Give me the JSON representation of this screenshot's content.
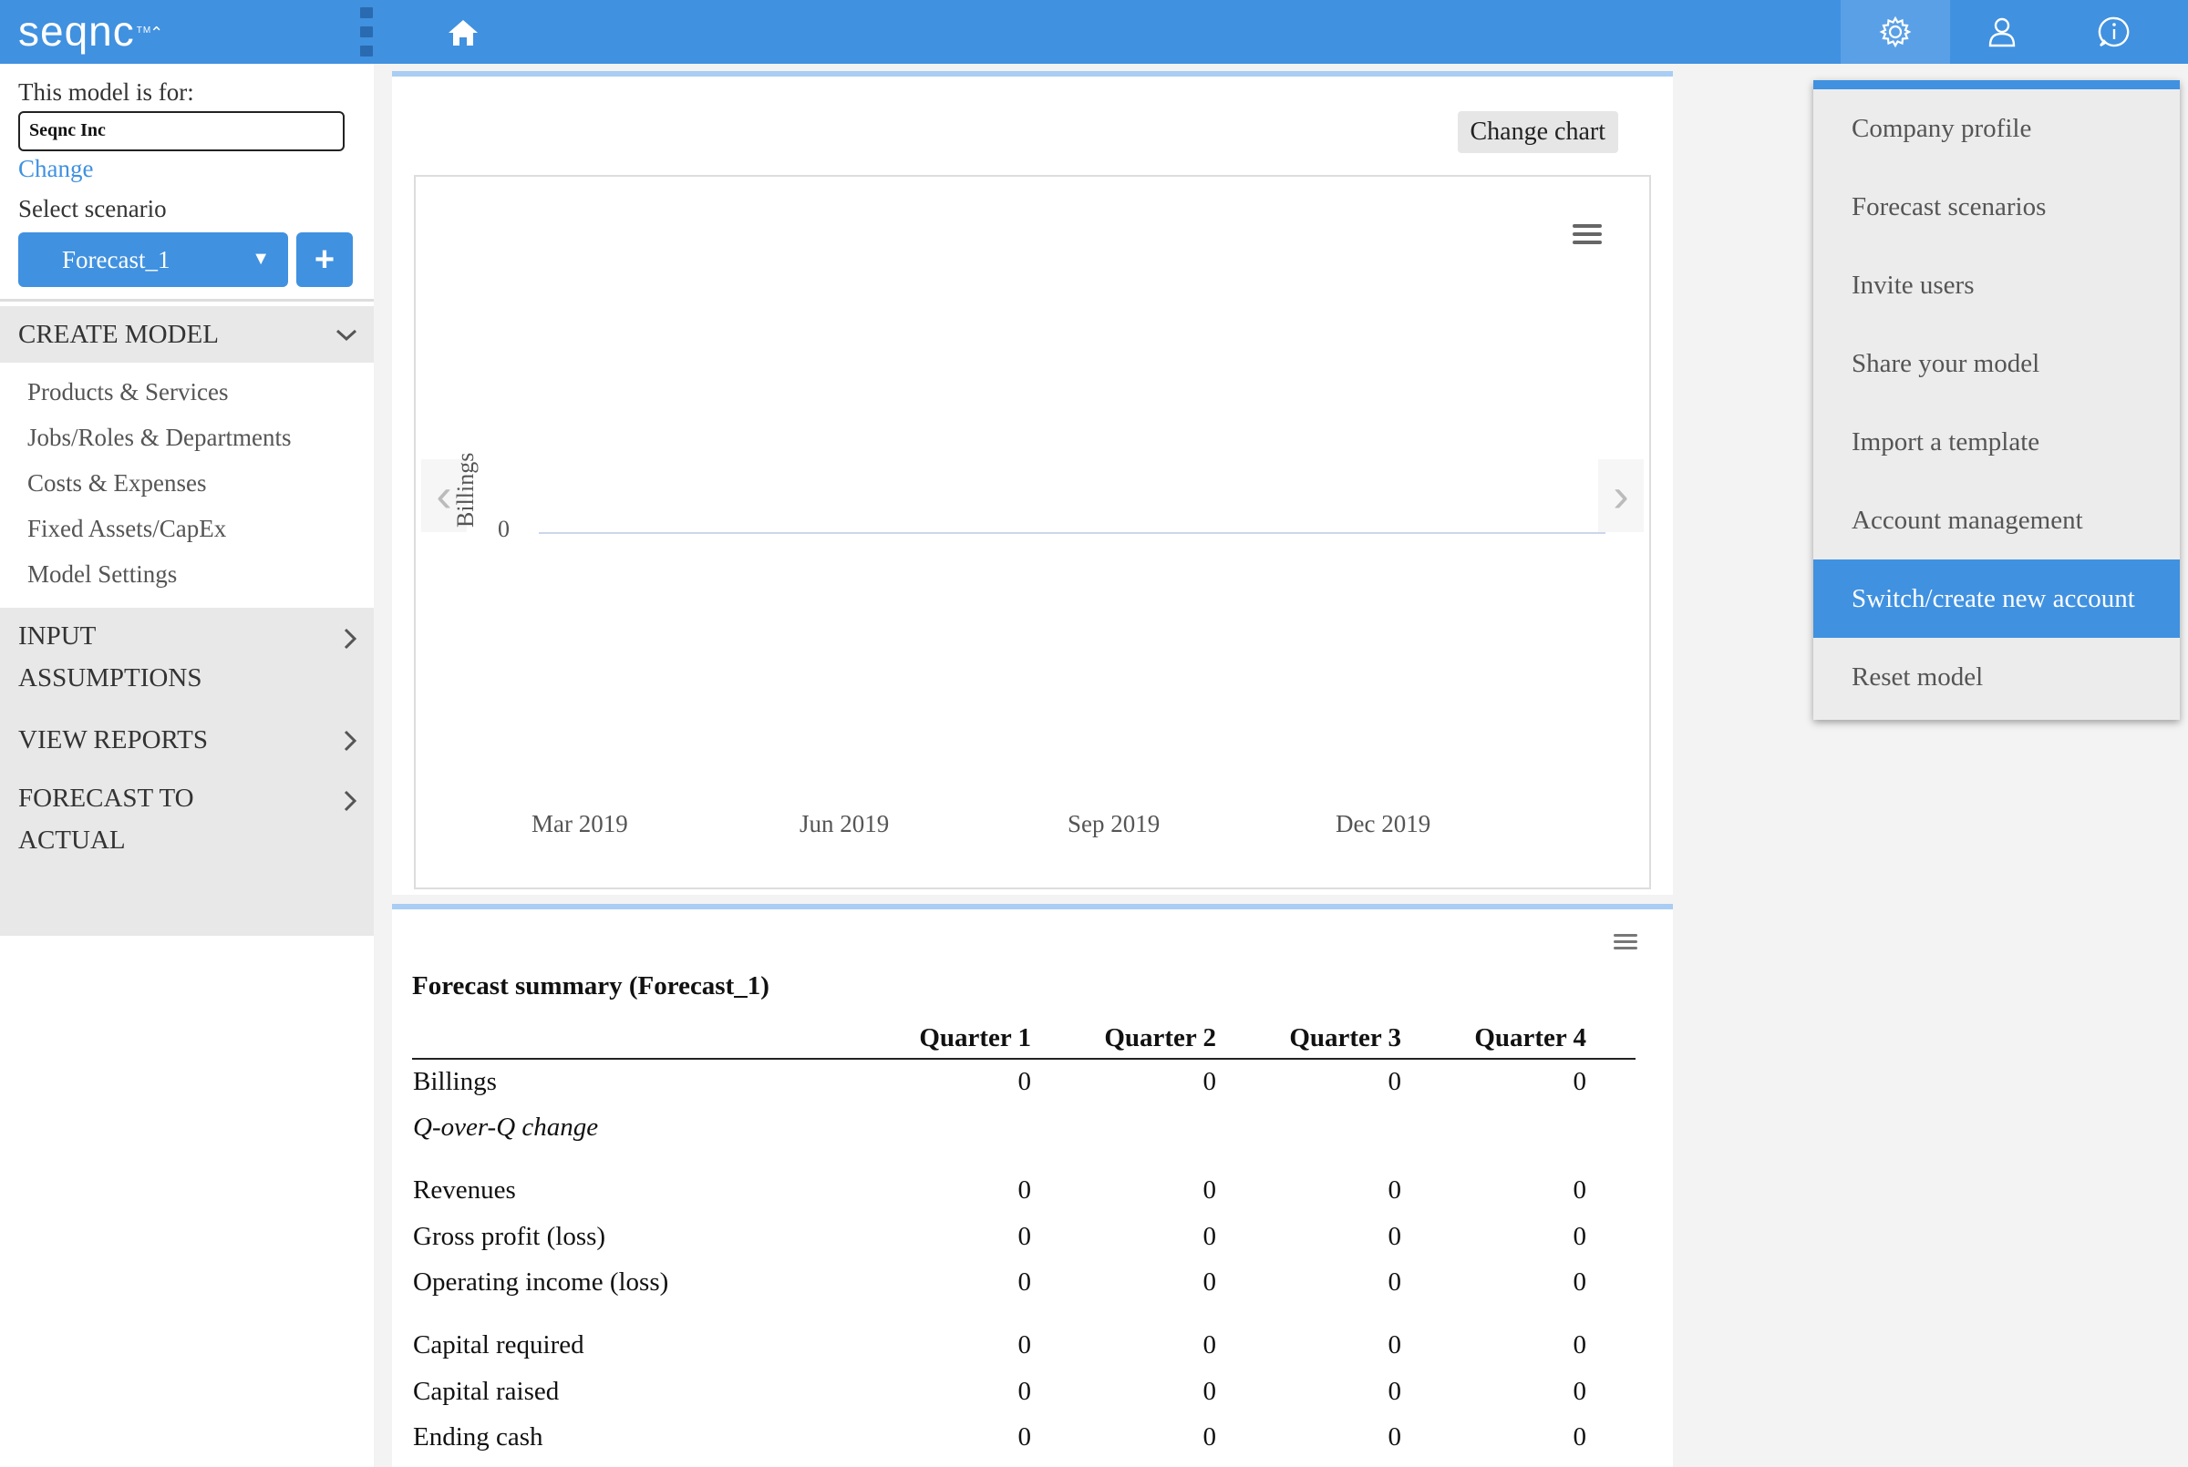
{
  "app": {
    "logo": "seqnc",
    "logo_tm": "TM"
  },
  "icons": {
    "home": "home-icon",
    "settings": "gear-icon",
    "user": "user-icon",
    "info": "info-icon",
    "chart_menu": "hamburger-menu-icon",
    "collapse": "sidebar-collapse-handle"
  },
  "colors": {
    "accent": "#4091e0",
    "active_icon_bg": "#5aa0e6",
    "sidebar_section_bg": "#e8e8e8",
    "card_top_border": "#a9cdf3"
  },
  "sidebar": {
    "model_for_label": "This model is for:",
    "company_name": "Seqnc Inc",
    "change_link": "Change",
    "select_scenario_label": "Select scenario",
    "scenario_value": "Forecast_1",
    "add_scenario_label": "+",
    "sections": [
      {
        "label": "CREATE MODEL",
        "expanded": true
      },
      {
        "label_line1": "INPUT",
        "label_line2": "ASSUMPTIONS"
      },
      {
        "label": "VIEW REPORTS"
      },
      {
        "label_line1": "FORECAST TO",
        "label_line2": "ACTUAL"
      }
    ],
    "create_model_items": [
      "Products & Services",
      "Jobs/Roles & Departments",
      "Costs & Expenses",
      "Fixed Assets/CapEx",
      "Model Settings"
    ]
  },
  "chart_card": {
    "change_chart_label": "Change chart"
  },
  "chart_data": {
    "type": "line",
    "ylabel": "Billings",
    "y_ticks": [
      "0"
    ],
    "categories": [
      "Mar 2019",
      "Jun 2019",
      "Sep 2019",
      "Dec 2019"
    ],
    "series": [
      {
        "values": [
          0,
          0,
          0,
          0
        ]
      }
    ],
    "grid": false
  },
  "summary": {
    "title": "Forecast summary (Forecast_1)",
    "columns": [
      "Quarter 1",
      "Quarter 2",
      "Quarter 3",
      "Quarter 4"
    ],
    "rows": [
      {
        "label": "Billings",
        "values": [
          "0",
          "0",
          "0",
          "0"
        ]
      },
      {
        "label": "Q-over-Q change",
        "values": [
          "",
          "",
          "",
          ""
        ],
        "italic": true
      },
      {
        "label": "Revenues",
        "values": [
          "0",
          "0",
          "0",
          "0"
        ],
        "gap": true
      },
      {
        "label": "Gross profit (loss)",
        "values": [
          "0",
          "0",
          "0",
          "0"
        ]
      },
      {
        "label": "Operating income (loss)",
        "values": [
          "0",
          "0",
          "0",
          "0"
        ]
      },
      {
        "label": "Capital required",
        "values": [
          "0",
          "0",
          "0",
          "0"
        ],
        "gap": true
      },
      {
        "label": "Capital raised",
        "values": [
          "0",
          "0",
          "0",
          "0"
        ]
      },
      {
        "label": "Ending cash",
        "values": [
          "0",
          "0",
          "0",
          "0"
        ]
      }
    ]
  },
  "settings_menu": {
    "items": [
      "Company profile",
      "Forecast scenarios",
      "Invite users",
      "Share your model",
      "Import a template",
      "Account management",
      "Switch/create new account",
      "Reset model"
    ],
    "active_item": "Switch/create new account"
  }
}
